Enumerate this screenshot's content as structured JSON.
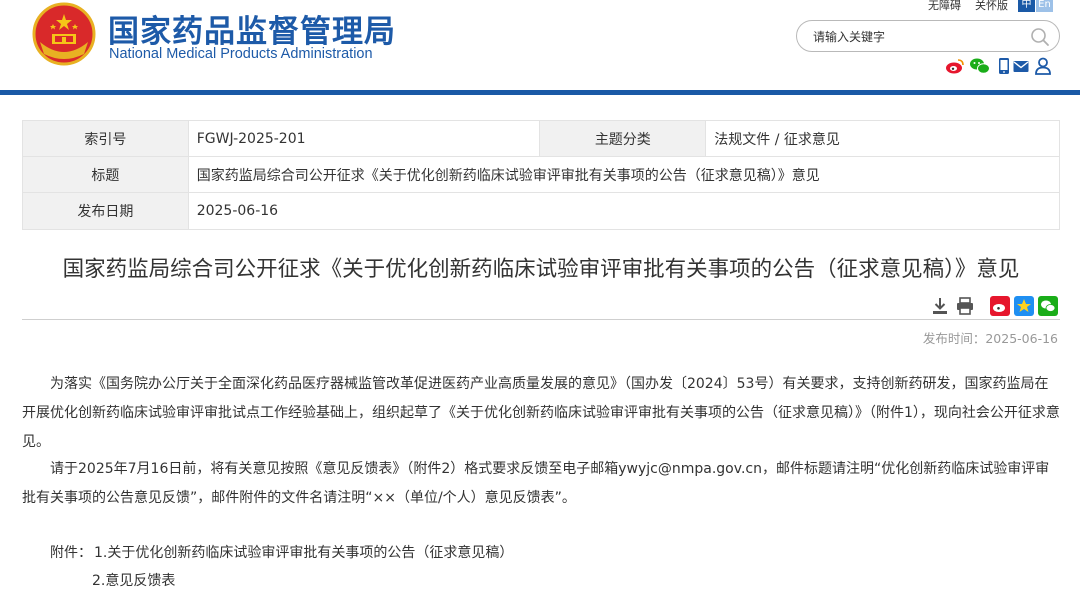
{
  "header": {
    "title_cn": "国家药品监督管理局",
    "title_en": "National Medical Products Administration",
    "links": [
      "无障碍",
      "关怀版"
    ],
    "lang_zh": "中",
    "lang_en": "En",
    "search_placeholder": "请输入关键字",
    "social_icons": [
      "weibo-icon",
      "wechat-icon",
      "email-icon",
      "user-icon"
    ]
  },
  "meta": {
    "index_label": "索引号",
    "index_value": "FGWJ-2025-201",
    "category_label": "主题分类",
    "category_value": "法规文件 / 征求意见",
    "title_label": "标题",
    "title_value": "国家药监局综合司公开征求《关于优化创新药临床试验审评审批有关事项的公告（征求意见稿）》意见",
    "date_label": "发布日期",
    "date_value": "2025-06-16"
  },
  "article": {
    "title": "国家药监局综合司公开征求《关于优化创新药临床试验审评审批有关事项的公告（征求意见稿）》意见",
    "publish_time": "发布时间：2025-06-16",
    "para1": "为落实《国务院办公厅关于全面深化药品医疗器械监管改革促进医药产业高质量发展的意见》（国办发〔2024〕53号）有关要求，支持创新药研发，国家药监局在开展优化创新药临床试验审评审批试点工作经验基础上，组织起草了《关于优化创新药临床试验审评审批有关事项的公告（征求意见稿）》（附件1），现向社会公开征求意见。",
    "para2": "请于2025年7月16日前，将有关意见按照《意见反馈表》（附件2）格式要求反馈至电子邮箱ywyjc@nmpa.gov.cn，邮件标题请注明“优化创新药临床试验审评审批有关事项的公告意见反馈”，邮件附件的文件名请注明“××（单位/个人）意见反馈表”。",
    "attachments_label": "附件：",
    "attachment1": "1.关于优化创新药临床试验审评审批有关事项的公告（征求意见稿）",
    "attachment2": "2.意见反馈表"
  },
  "colors": {
    "brand_blue": "#1d5aa8",
    "header_rule": "#1a59a6",
    "label_bg": "#f1f1f1"
  }
}
